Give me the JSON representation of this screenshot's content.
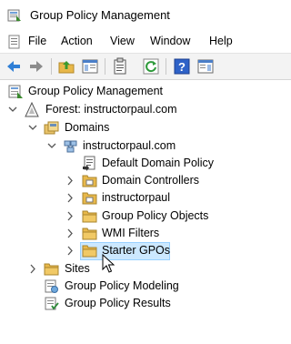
{
  "window": {
    "title": "Group Policy Management"
  },
  "menu": {
    "items": [
      {
        "label": "File"
      },
      {
        "label": "Action"
      },
      {
        "label": "View"
      },
      {
        "label": "Window"
      },
      {
        "label": "Help"
      }
    ]
  },
  "toolbar": {
    "buttons": [
      {
        "icon": "back-arrow-icon"
      },
      {
        "icon": "forward-arrow-icon"
      },
      {
        "icon": "up-folder-icon"
      },
      {
        "icon": "show-hide-tree-icon"
      },
      {
        "icon": "properties-icon"
      },
      {
        "icon": "refresh-icon"
      },
      {
        "icon": "help-icon"
      },
      {
        "icon": "show-action-pane-icon"
      }
    ]
  },
  "tree": {
    "root": "Group Policy Management",
    "forest": "Forest: instructorpaul.com",
    "domains": "Domains",
    "domain": "instructorpaul.com",
    "default_domain_policy": "Default Domain Policy",
    "domain_controllers": "Domain Controllers",
    "ou": "instructorpaul",
    "gpo": "Group Policy Objects",
    "wmi": "WMI Filters",
    "starter": "Starter GPOs",
    "sites": "Sites",
    "modeling": "Group Policy Modeling",
    "results": "Group Policy Results",
    "selected_item": "Starter GPOs"
  }
}
